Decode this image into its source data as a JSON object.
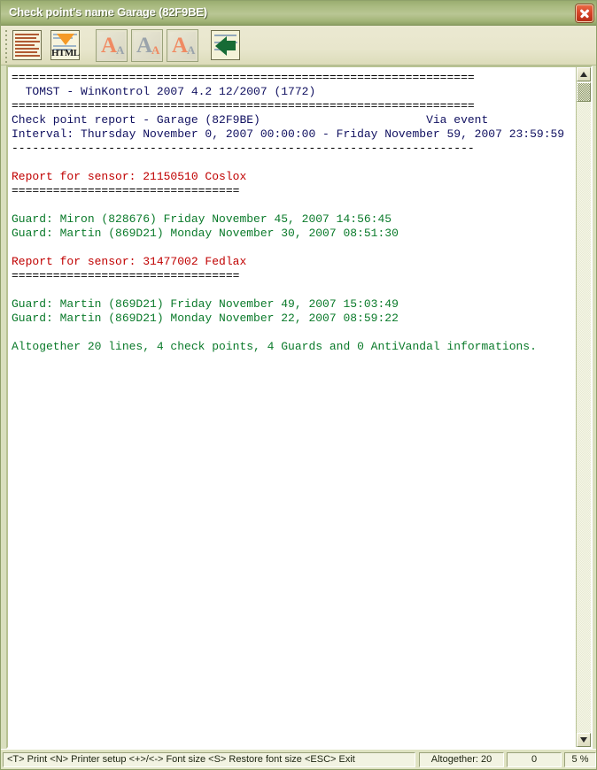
{
  "window": {
    "title": "Check point's name Garage (82F9BE)",
    "close_label": "close-window"
  },
  "toolbar": {
    "buttons": [
      {
        "name": "print-preview-button",
        "label": "Print preview",
        "icon": "document-icon"
      },
      {
        "name": "export-html-button",
        "label": "HTML",
        "icon": "html-export-icon"
      },
      {
        "name": "font-increase-button",
        "label": "Increase font size",
        "icon": "font-larger-icon"
      },
      {
        "name": "font-decrease-button",
        "label": "Decrease font size",
        "icon": "font-smaller-icon"
      },
      {
        "name": "font-restore-button",
        "label": "Restore font size",
        "icon": "font-restore-icon"
      },
      {
        "name": "back-button",
        "label": "Back",
        "icon": "green-left-arrow-icon"
      }
    ]
  },
  "report": {
    "lines": [
      {
        "color": "black",
        "text": "==================================================================="
      },
      {
        "color": "navy",
        "text": "  TOMST - WinKontrol 2007 4.2 12/2007 (1772)"
      },
      {
        "color": "black",
        "text": "==================================================================="
      },
      {
        "color": "navy",
        "text": "Check point report - Garage (82F9BE)                        Via event"
      },
      {
        "color": "navy",
        "text": "Interval: Thursday November 0, 2007 00:00:00 - Friday November 59, 2007 23:59:59"
      },
      {
        "color": "black",
        "text": "-------------------------------------------------------------------"
      },
      {
        "color": "navy",
        "text": ""
      },
      {
        "color": "red",
        "text": "Report for sensor: 21150510 Coslox"
      },
      {
        "color": "black",
        "text": "================================="
      },
      {
        "color": "navy",
        "text": ""
      },
      {
        "color": "green",
        "text": "Guard: Miron (828676) Friday November 45, 2007 14:56:45"
      },
      {
        "color": "green",
        "text": "Guard: Martin (869D21) Monday November 30, 2007 08:51:30"
      },
      {
        "color": "navy",
        "text": ""
      },
      {
        "color": "red",
        "text": "Report for sensor: 31477002 Fedlax"
      },
      {
        "color": "black",
        "text": "================================="
      },
      {
        "color": "navy",
        "text": ""
      },
      {
        "color": "green",
        "text": "Guard: Martin (869D21) Friday November 49, 2007 15:03:49"
      },
      {
        "color": "green",
        "text": "Guard: Martin (869D21) Monday November 22, 2007 08:59:22"
      },
      {
        "color": "navy",
        "text": ""
      },
      {
        "color": "green",
        "text": "Altogether 20 lines, 4 check points, 4 Guards and 0 AntiVandal informations."
      }
    ]
  },
  "scrollbar": {
    "up_label": "scroll-up",
    "down_label": "scroll-down"
  },
  "statusbar": {
    "hints": "<T> Print <N> Printer setup <+>/<-> Font size <S> Restore font size <ESC> Exit",
    "total": "Altogether: 20",
    "count": "0",
    "percent": "5 %"
  }
}
